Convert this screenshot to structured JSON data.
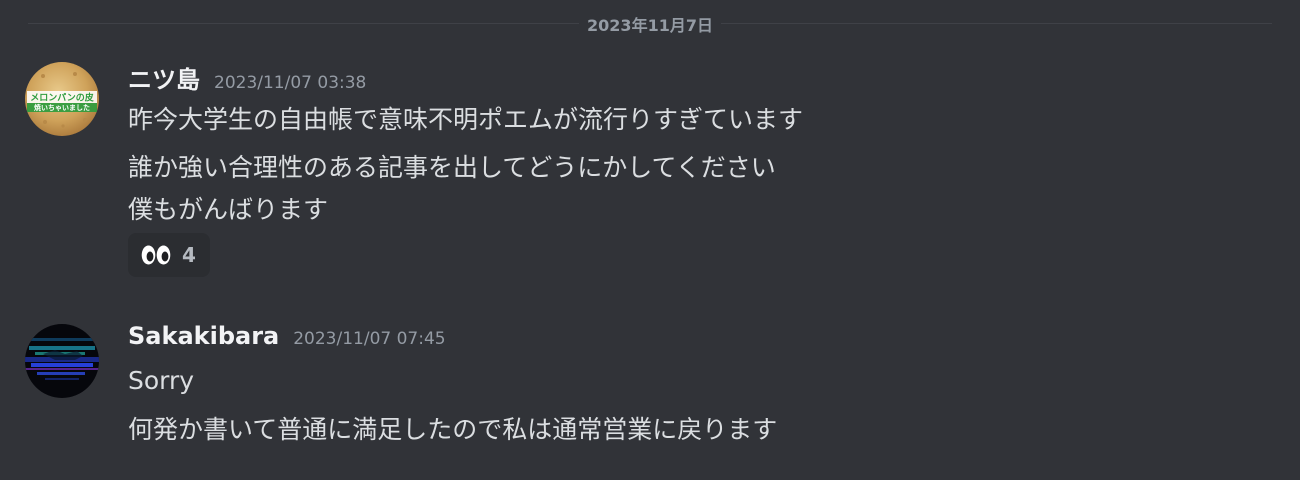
{
  "divider": {
    "date": "2023年11月7日"
  },
  "messages": [
    {
      "username": "ニツ島",
      "timestamp": "2023/11/07 03:38",
      "avatar": "melon-pan-avatar",
      "avatar_text": [
        "メロンパンの皮",
        "焼いちゃいました"
      ],
      "lines": [
        "昨今大学生の自由帳で意味不明ポエムが流行りすぎています",
        "誰か強い合理性のある記事を出してどうにかしてください",
        "僕もがんばります"
      ],
      "reaction": {
        "emoji": "eyes-emoji",
        "count": "4"
      }
    },
    {
      "username": "Sakakibara",
      "timestamp": "2023/11/07 07:45",
      "avatar": "dark-glitch-avatar",
      "lines": [
        "Sorry",
        "何発か書いて普通に満足したので私は通常営業に戻ります"
      ]
    }
  ],
  "colors": {
    "background": "#313338",
    "username": "#f2f3f5",
    "text": "#dbdee1",
    "muted": "#949ba4",
    "reaction_bg": "#2b2d31"
  }
}
